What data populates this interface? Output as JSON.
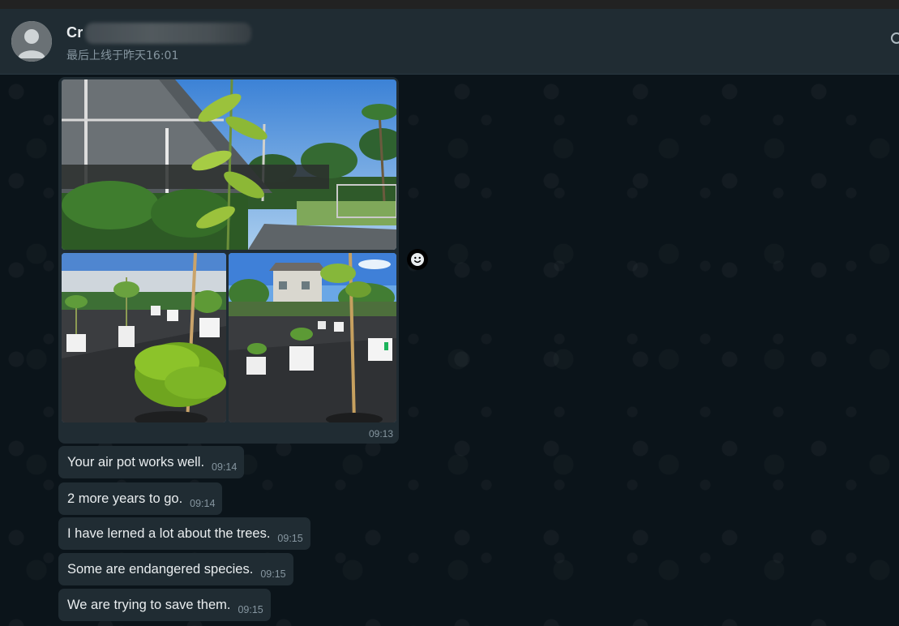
{
  "header": {
    "contact_name": "Cr",
    "last_seen": "最后上线于昨天16:01"
  },
  "messages": [
    {
      "type": "album",
      "time": "09:13",
      "images": [
        "greenhouse-and-palm-trees-photo",
        "potted-saplings-with-fern-photo",
        "potted-saplings-near-house-photo"
      ]
    },
    {
      "type": "text",
      "text": "Your air pot works well.",
      "time": "09:14"
    },
    {
      "type": "text",
      "text": "2 more years to go.",
      "time": "09:14"
    },
    {
      "type": "text",
      "text": "I have lerned a lot about the trees.",
      "time": "09:15"
    },
    {
      "type": "text",
      "text": "Some are endangered species.",
      "time": "09:15"
    },
    {
      "type": "text",
      "text": "We are trying to save them.",
      "time": "09:15"
    }
  ],
  "colors": {
    "header_bg": "#202c33",
    "chat_bg": "#0b141a",
    "bubble_bg": "#202c33",
    "text": "#e9edef",
    "muted": "#8696a0"
  },
  "icons": {
    "avatar": "default-avatar-icon",
    "reaction": "smiley-icon"
  }
}
